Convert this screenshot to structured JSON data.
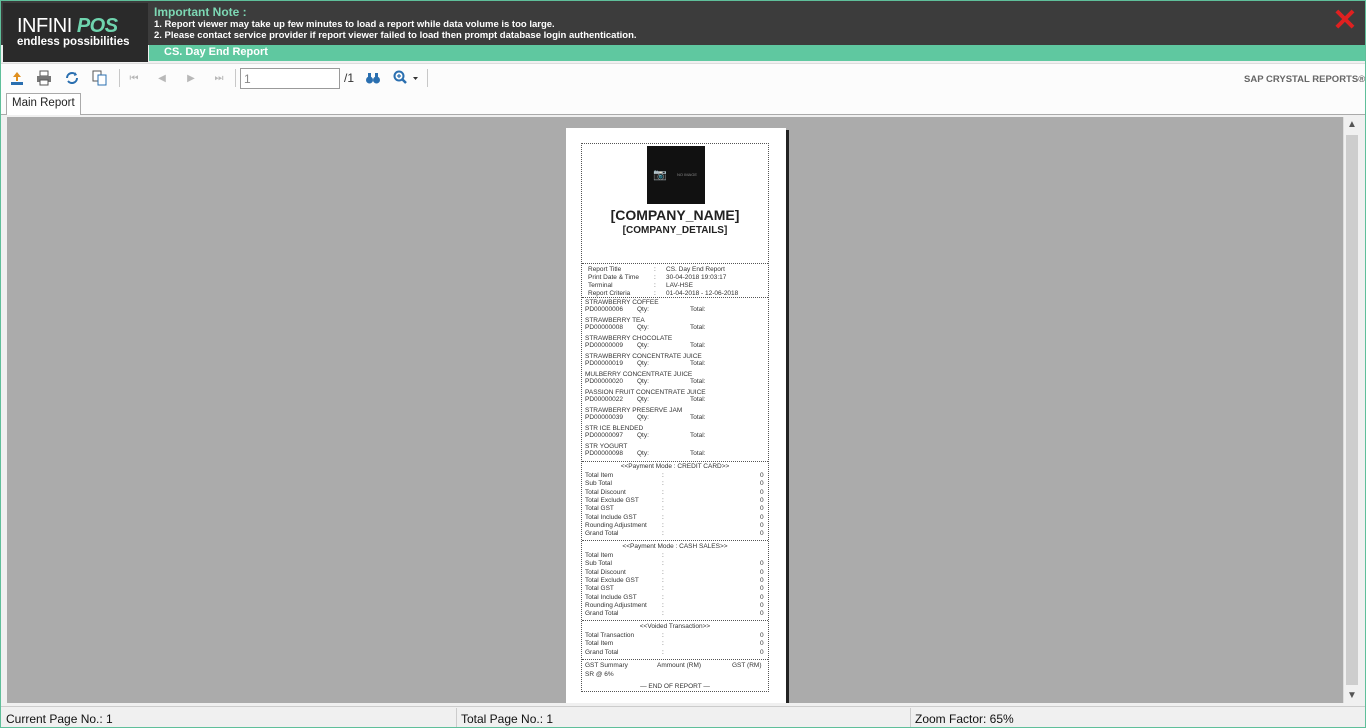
{
  "header": {
    "logo_main": "INFINI",
    "logo_accent": "POS",
    "logo_tagline": "endless possibilities",
    "note_title": "Important Note :",
    "note_lines": [
      "1. Report viewer may take up few minutes to load a report while data volume is too large.",
      "2. Please contact service provider if report viewer failed to load then prompt database login authentication."
    ],
    "close_icon": "✕",
    "report_name": "CS. Day End Report"
  },
  "toolbar": {
    "icons": [
      "export-icon",
      "print-icon",
      "refresh-icon",
      "toggle-group-tree-icon",
      "first-page-icon",
      "previous-page-icon",
      "next-page-icon",
      "last-page-icon",
      "find-binoculars-icon",
      "zoom-icon"
    ],
    "page_value": "1",
    "page_total": "/1",
    "brand": "SAP CRYSTAL REPORTS®"
  },
  "tabs": {
    "main": "Main Report"
  },
  "report": {
    "company_name": "[COMPANY_NAME]",
    "company_details": "[COMPANY_DETAILS]",
    "image_text": "NO IMAGE",
    "info": [
      {
        "k": "Report Title",
        "v": "CS. Day End Report"
      },
      {
        "k": "Print Date & Time",
        "v": "30-04-2018 19:03:17"
      },
      {
        "k": "Terminal",
        "v": "LAV-HSE"
      },
      {
        "k": "Report Criteria",
        "v": "01-04-2018 - 12-06-2018"
      }
    ],
    "items": [
      {
        "name": "STRAWBERRY COFFEE",
        "code": "PD00000006"
      },
      {
        "name": "STRAWBERRY TEA",
        "code": "PD00000008"
      },
      {
        "name": "STRAWBERRY CHOCOLATE",
        "code": "PD00000009"
      },
      {
        "name": "STRAWBERRY CONCENTRATE JUICE",
        "code": "PD00000019"
      },
      {
        "name": "MULBERRY CONCENTRATE JUICE",
        "code": "PD00000020"
      },
      {
        "name": "PASSION FRUIT CONCENTRATE JUICE",
        "code": "PD00000022"
      },
      {
        "name": "STRAWBERRY PRESERVE JAM",
        "code": "PD00000039"
      },
      {
        "name": "STR ICE BLENDED",
        "code": "PD00000097"
      },
      {
        "name": "STR YOGURT",
        "code": "PD00000098"
      }
    ],
    "qty_label": "Qty:",
    "total_label": "Total:",
    "credit_title": "<<Payment Mode : CREDIT CARD>>",
    "credit_rows": [
      {
        "k": "Total Item",
        "v": "0"
      },
      {
        "k": "Sub Total",
        "v": "0"
      },
      {
        "k": "Total Discount",
        "v": "0"
      },
      {
        "k": "Total Exclude GST",
        "v": "0"
      },
      {
        "k": "Total GST",
        "v": "0"
      },
      {
        "k": "Total Include GST",
        "v": "0"
      },
      {
        "k": "Rounding Adjustment",
        "v": "0"
      },
      {
        "k": "Grand Total",
        "v": "0"
      }
    ],
    "cash_title": "<<Payment Mode : CASH SALES>>",
    "cash_rows": [
      {
        "k": "Total Item",
        "v": ""
      },
      {
        "k": "Sub Total",
        "v": "0"
      },
      {
        "k": "Total Discount",
        "v": "0"
      },
      {
        "k": "Total Exclude GST",
        "v": "0"
      },
      {
        "k": "Total GST",
        "v": "0"
      },
      {
        "k": "Total Include GST",
        "v": "0"
      },
      {
        "k": "Rounding Adjustment",
        "v": "0"
      },
      {
        "k": "Grand Total",
        "v": "0"
      }
    ],
    "voided_title": "<<Voided Transaction>>",
    "voided_rows": [
      {
        "k": "Total Transaction",
        "v": "0"
      },
      {
        "k": "Total Item",
        "v": "0"
      },
      {
        "k": "Grand Total",
        "v": "0"
      }
    ],
    "gst_summary": "GST Summary",
    "gst_amount": "Ammount (RM)",
    "gst_col": "GST (RM)",
    "gst_row": "SR @ 6%",
    "end": "— END OF REPORT —"
  },
  "statusbar": {
    "current": "Current Page No.: 1",
    "total": "Total Page No.: 1",
    "zoom": "Zoom Factor: 65%"
  }
}
